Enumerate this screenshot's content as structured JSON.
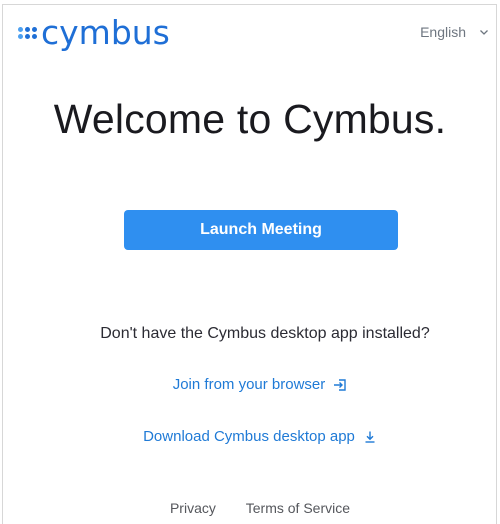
{
  "header": {
    "logo_text": "cymbus",
    "brand_color": "#1f6fd6",
    "language": "English",
    "language_icon": "chevron-down-icon"
  },
  "main": {
    "title": "Welcome to Cymbus.",
    "launch_button": "Launch Meeting",
    "launch_color": "#2f8ff0",
    "prompt": "Don't have the Cymbus desktop app installed?",
    "join_link": "Join from your browser",
    "join_icon": "enter-icon",
    "download_link": "Download Cymbus desktop app",
    "download_icon": "download-icon",
    "link_color": "#1f7ad6"
  },
  "footer": {
    "privacy": "Privacy",
    "terms": "Terms of Service"
  }
}
